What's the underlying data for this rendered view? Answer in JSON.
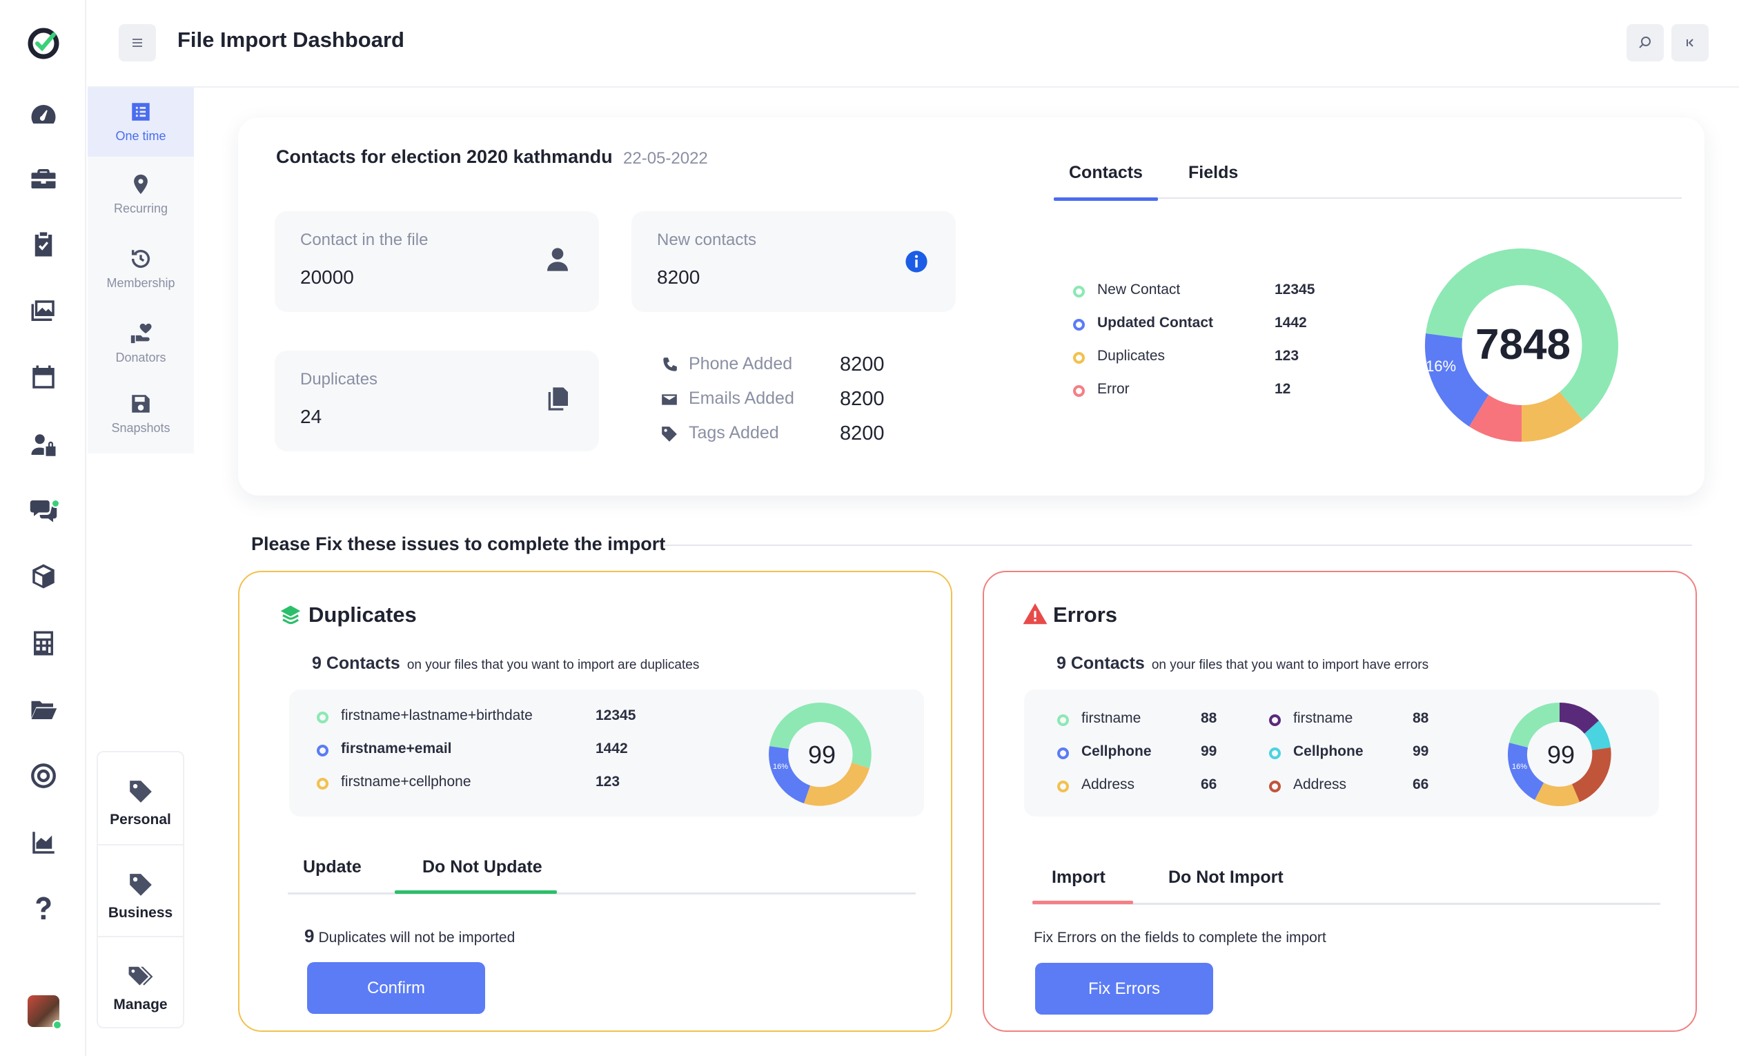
{
  "header": {
    "title": "File Import Dashboard"
  },
  "submenu": [
    {
      "label": "One time",
      "icon": "list-icon",
      "active": true
    },
    {
      "label": "Recurring",
      "icon": "location-pin-icon"
    },
    {
      "label": "Membership",
      "icon": "history-icon"
    },
    {
      "label": "Donators",
      "icon": "heart-hand-icon"
    },
    {
      "label": "Snapshots",
      "icon": "save-icon"
    }
  ],
  "tag_menu": [
    {
      "label": "Personal",
      "icon": "tag-icon"
    },
    {
      "label": "Business",
      "icon": "tag-icon"
    },
    {
      "label": "Manage",
      "icon": "tags-icon"
    }
  ],
  "summary": {
    "title": "Contacts for election 2020 kathmandu",
    "date": "22-05-2022",
    "contact_in_file": {
      "label": "Contact in the file",
      "value": "20000"
    },
    "new_contacts": {
      "label": "New contacts",
      "value": "8200"
    },
    "duplicates": {
      "label": "Duplicates",
      "value": "24"
    },
    "added": [
      {
        "label": "Phone Added",
        "value": "8200",
        "icon": "phone-icon"
      },
      {
        "label": "Emails Added",
        "value": "8200",
        "icon": "mail-icon"
      },
      {
        "label": "Tags Added",
        "value": "8200",
        "icon": "tag-icon"
      }
    ],
    "tabs": [
      "Contacts",
      "Fields"
    ],
    "legend": [
      {
        "label": "New Contact",
        "value": "12345",
        "color": "#8de8b4"
      },
      {
        "label": "Updated Contact",
        "value": "1442",
        "color": "#5b7cf5"
      },
      {
        "label": "Duplicates",
        "value": "123",
        "color": "#f2c14e"
      },
      {
        "label": "Error",
        "value": "12",
        "color": "#f47f86"
      }
    ],
    "donut": {
      "center": "7848",
      "label": "16%",
      "segments": [
        {
          "color": "#8de8b4",
          "fraction": 0.48
        },
        {
          "color": "#f2bc5a",
          "fraction": 0.17
        },
        {
          "color": "#f7747c",
          "fraction": 0.09
        },
        {
          "color": "#5b7cf5",
          "fraction": 0.16
        }
      ]
    }
  },
  "issues_heading": "Please Fix these issues to  complete the import",
  "duplicates_panel": {
    "title": "Duplicates",
    "count": "9 Contacts",
    "desc": "on your files that you want to import are duplicates",
    "rows": [
      {
        "label": "firstname+lastname+birthdate",
        "value": "12345",
        "color": "#8de8b4"
      },
      {
        "label": "firstname+email",
        "value": "1442",
        "color": "#5b7cf5"
      },
      {
        "label": "firstname+cellphone",
        "value": "123",
        "color": "#f2c14e"
      }
    ],
    "donut": {
      "center": "99",
      "label": "16%"
    },
    "tabs": [
      "Update",
      "Do Not Update"
    ],
    "note_num": "9",
    "note": "Duplicates will not be imported",
    "button": "Confirm"
  },
  "errors_panel": {
    "title": "Errors",
    "count": "9 Contacts",
    "desc": "on your files that you want to import have errors",
    "rows_left": [
      {
        "label": "firstname",
        "value": "88",
        "color": "#8de8b4"
      },
      {
        "label": "Cellphone",
        "value": "99",
        "color": "#5b7cf5"
      },
      {
        "label": "Address",
        "value": "66",
        "color": "#f2c14e"
      }
    ],
    "rows_right": [
      {
        "label": "firstname",
        "value": "88",
        "color": "#5a2a7a"
      },
      {
        "label": "Cellphone",
        "value": "99",
        "color": "#4ad3e0"
      },
      {
        "label": "Address",
        "value": "66",
        "color": "#c0553a"
      }
    ],
    "donut": {
      "center": "99",
      "label": "16%"
    },
    "tabs": [
      "Import",
      "Do Not Import"
    ],
    "note": "Fix Errors on the fields to complete the import",
    "button": "Fix Errors"
  }
}
